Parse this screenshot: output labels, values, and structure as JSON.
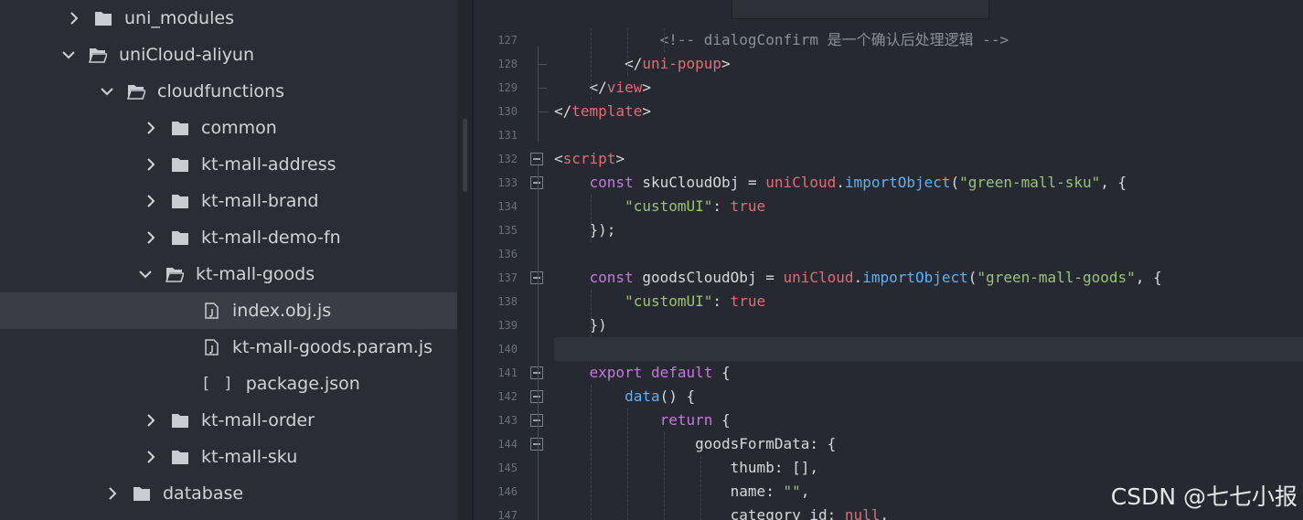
{
  "sidebar": {
    "items": [
      {
        "label": "uni_modules",
        "state": "collapsed",
        "icon": "folder-icon"
      },
      {
        "label": "uniCloud-aliyun",
        "state": "expanded",
        "icon": "folder-open-icon"
      },
      {
        "label": "cloudfunctions",
        "state": "expanded",
        "icon": "folder-open-icon"
      },
      {
        "label": "common",
        "state": "collapsed",
        "icon": "folder-icon"
      },
      {
        "label": "kt-mall-address",
        "state": "collapsed",
        "icon": "folder-icon"
      },
      {
        "label": "kt-mall-brand",
        "state": "collapsed",
        "icon": "folder-icon"
      },
      {
        "label": "kt-mall-demo-fn",
        "state": "collapsed",
        "icon": "folder-icon"
      },
      {
        "label": "kt-mall-goods",
        "state": "expanded",
        "icon": "folder-open-icon"
      },
      {
        "label": "index.obj.js",
        "state": "file",
        "icon": "js-file-icon",
        "selected": true
      },
      {
        "label": "kt-mall-goods.param.js",
        "state": "file",
        "icon": "js-file-icon"
      },
      {
        "label": "package.json",
        "state": "file",
        "icon": "json-file-icon",
        "bracket": "[ ]"
      },
      {
        "label": "kt-mall-order",
        "state": "collapsed",
        "icon": "folder-icon"
      },
      {
        "label": "kt-mall-sku",
        "state": "collapsed",
        "icon": "folder-icon"
      },
      {
        "label": "database",
        "state": "collapsed",
        "icon": "folder-icon"
      }
    ]
  },
  "editor": {
    "lines": [
      {
        "n": "127",
        "t": "            <!-- dialogConfirm 是一个确认后处理逻辑 -->"
      },
      {
        "n": "128",
        "t": "        </uni-popup>"
      },
      {
        "n": "129",
        "t": "    </view>"
      },
      {
        "n": "130",
        "t": "</template>"
      },
      {
        "n": "131",
        "t": ""
      },
      {
        "n": "132",
        "t": "<script>"
      },
      {
        "n": "133",
        "t": "    const skuCloudObj = uniCloud.importObject(\"green-mall-sku\", {"
      },
      {
        "n": "134",
        "t": "        \"customUI\": true"
      },
      {
        "n": "135",
        "t": "    });"
      },
      {
        "n": "136",
        "t": ""
      },
      {
        "n": "137",
        "t": "    const goodsCloudObj = uniCloud.importObject(\"green-mall-goods\", {"
      },
      {
        "n": "138",
        "t": "        \"customUI\": true"
      },
      {
        "n": "139",
        "t": "    })"
      },
      {
        "n": "140",
        "t": ""
      },
      {
        "n": "141",
        "t": "    export default {"
      },
      {
        "n": "142",
        "t": "        data() {"
      },
      {
        "n": "143",
        "t": "            return {"
      },
      {
        "n": "144",
        "t": "                goodsFormData: {"
      },
      {
        "n": "145",
        "t": "                    thumb: [],"
      },
      {
        "n": "146",
        "t": "                    name: \"\","
      },
      {
        "n": "147",
        "t": "                    category_id: null,"
      }
    ]
  },
  "watermark": "CSDN @七七小报",
  "colors": {
    "sidebar_bg": "#2a2d35",
    "editor_bg": "#262931",
    "tag": "#e06c75",
    "keyword": "#c678dd",
    "function": "#61afef",
    "string": "#98c379"
  }
}
